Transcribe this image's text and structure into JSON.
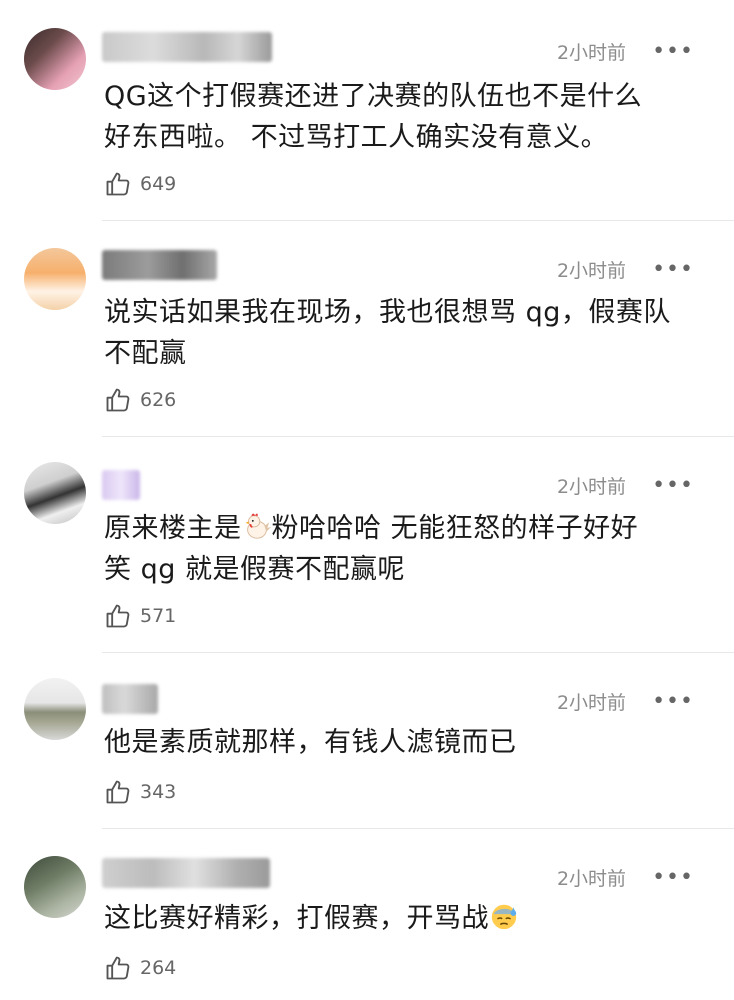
{
  "comments": [
    {
      "time": "2小时前",
      "more": "•••",
      "text": "QG这个打假赛还进了决赛的队伍也不是什么\n好东西啦。 不过骂打工人确实没有意义。",
      "likes": "649"
    },
    {
      "time": "2小时前",
      "more": "•••",
      "text": "说实话如果我在现场，我也很想骂 qg，假赛队\n不配赢",
      "likes": "626"
    },
    {
      "time": "2小时前",
      "more": "•••",
      "text_a": "原来楼主是",
      "emoji": "chicken-emoji",
      "text_b": "粉哈哈哈 无能狂怒的样子好好\n笑 qg 就是假赛不配赢呢",
      "likes": "571"
    },
    {
      "time": "2小时前",
      "more": "•••",
      "text": "他是素质就那样，有钱人滤镜而已",
      "likes": "343"
    },
    {
      "time": "2小时前",
      "more": "•••",
      "text": "这比赛好精彩，打假赛，开骂战",
      "emoji": "sweat-face-emoji",
      "likes": "264"
    }
  ]
}
